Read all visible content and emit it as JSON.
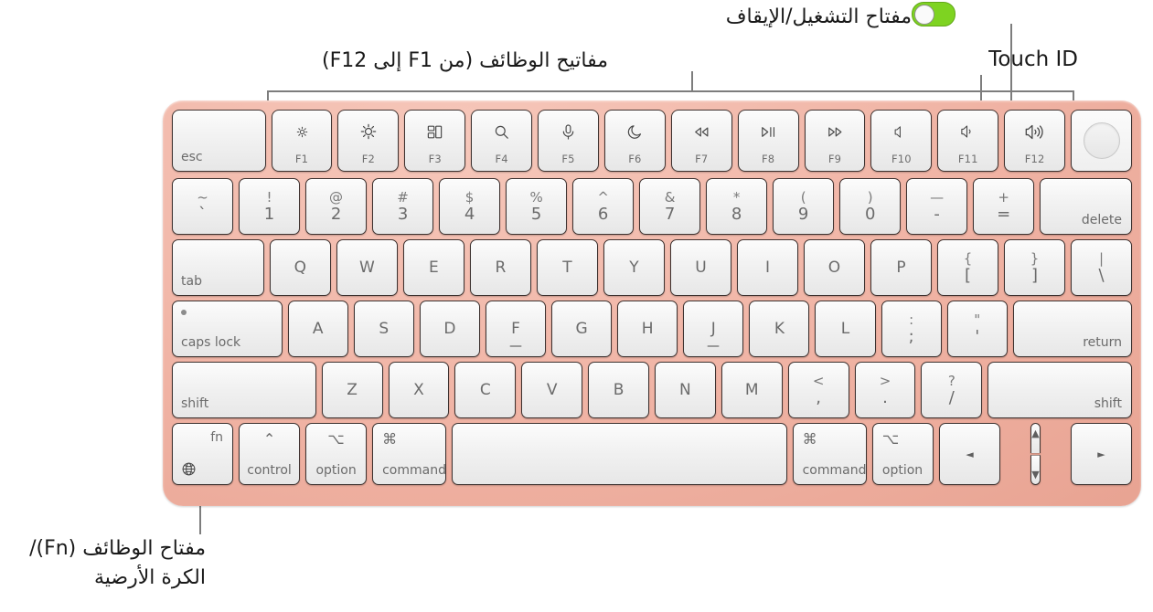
{
  "annotations": {
    "power_key": "مفتاح التشغيل/الإيقاف",
    "touch_id": "Touch ID",
    "function_keys": "مفاتيح الوظائف (من F1 إلى F12)",
    "fn_globe_key": "مفتاح الوظائف (Fn)/الكرة الأرضية"
  },
  "colors": {
    "keyboard_body": "#f0b3a4",
    "key_face": "#f2f2f2",
    "key_border": "#3d3230",
    "legend_text": "#6b6b6b",
    "leader_line": "#7d7d7d",
    "toggle_on": "#7ed321"
  },
  "keyboard": {
    "function_row": [
      {
        "name": "esc",
        "label": "esc",
        "caption": "",
        "icon": "",
        "width": 1.55,
        "style": "corner-bl"
      },
      {
        "name": "f1",
        "label": "",
        "caption": "F1",
        "icon": "brightness-down-icon",
        "width": 1.0,
        "style": "fnkey"
      },
      {
        "name": "f2",
        "label": "",
        "caption": "F2",
        "icon": "brightness-up-icon",
        "width": 1.0,
        "style": "fnkey"
      },
      {
        "name": "f3",
        "label": "",
        "caption": "F3",
        "icon": "mission-control-icon",
        "width": 1.0,
        "style": "fnkey"
      },
      {
        "name": "f4",
        "label": "",
        "caption": "F4",
        "icon": "search-icon",
        "width": 1.0,
        "style": "fnkey"
      },
      {
        "name": "f5",
        "label": "",
        "caption": "F5",
        "icon": "microphone-icon",
        "width": 1.0,
        "style": "fnkey"
      },
      {
        "name": "f6",
        "label": "",
        "caption": "F6",
        "icon": "moon-icon",
        "width": 1.0,
        "style": "fnkey"
      },
      {
        "name": "f7",
        "label": "",
        "caption": "F7",
        "icon": "rewind-icon",
        "width": 1.0,
        "style": "fnkey"
      },
      {
        "name": "f8",
        "label": "",
        "caption": "F8",
        "icon": "play-pause-icon",
        "width": 1.0,
        "style": "fnkey"
      },
      {
        "name": "f9",
        "label": "",
        "caption": "F9",
        "icon": "fast-forward-icon",
        "width": 1.0,
        "style": "fnkey"
      },
      {
        "name": "f10",
        "label": "",
        "caption": "F10",
        "icon": "mute-icon",
        "width": 1.0,
        "style": "fnkey"
      },
      {
        "name": "f11",
        "label": "",
        "caption": "F11",
        "icon": "volume-down-icon",
        "width": 1.0,
        "style": "fnkey"
      },
      {
        "name": "f12",
        "label": "",
        "caption": "F12",
        "icon": "volume-up-icon",
        "width": 1.0,
        "style": "fnkey"
      },
      {
        "name": "touch-id",
        "label": "",
        "caption": "",
        "icon": "touch-id-icon",
        "width": 1.0,
        "style": "touchid"
      }
    ],
    "number_row": [
      {
        "name": "grave",
        "top": "~",
        "bottom": "`",
        "width": 1.0
      },
      {
        "name": "one",
        "top": "!",
        "bottom": "1",
        "width": 1.0
      },
      {
        "name": "two",
        "top": "@",
        "bottom": "2",
        "width": 1.0
      },
      {
        "name": "three",
        "top": "#",
        "bottom": "3",
        "width": 1.0
      },
      {
        "name": "four",
        "top": "$",
        "bottom": "4",
        "width": 1.0
      },
      {
        "name": "five",
        "top": "%",
        "bottom": "5",
        "width": 1.0
      },
      {
        "name": "six",
        "top": "^",
        "bottom": "6",
        "width": 1.0
      },
      {
        "name": "seven",
        "top": "&",
        "bottom": "7",
        "width": 1.0
      },
      {
        "name": "eight",
        "top": "*",
        "bottom": "8",
        "width": 1.0
      },
      {
        "name": "nine",
        "top": "(",
        "bottom": "9",
        "width": 1.0
      },
      {
        "name": "zero",
        "top": ")",
        "bottom": "0",
        "width": 1.0
      },
      {
        "name": "minus",
        "top": "—",
        "bottom": "-",
        "width": 1.0
      },
      {
        "name": "equals",
        "top": "+",
        "bottom": "=",
        "width": 1.0
      },
      {
        "name": "delete",
        "top": "",
        "bottom": "delete",
        "width": 1.52,
        "style": "corner-br"
      }
    ],
    "qwerty_row": [
      {
        "name": "tab",
        "label": "tab",
        "width": 1.52,
        "style": "corner-bl"
      },
      {
        "name": "q",
        "label": "Q",
        "width": 1.0
      },
      {
        "name": "w",
        "label": "W",
        "width": 1.0
      },
      {
        "name": "e",
        "label": "E",
        "width": 1.0
      },
      {
        "name": "r",
        "label": "R",
        "width": 1.0
      },
      {
        "name": "t",
        "label": "T",
        "width": 1.0
      },
      {
        "name": "y",
        "label": "Y",
        "width": 1.0
      },
      {
        "name": "u",
        "label": "U",
        "width": 1.0
      },
      {
        "name": "i",
        "label": "I",
        "width": 1.0
      },
      {
        "name": "o",
        "label": "O",
        "width": 1.0
      },
      {
        "name": "p",
        "label": "P",
        "width": 1.0
      },
      {
        "name": "bracket-left",
        "top": "{",
        "bottom": "[",
        "width": 1.0,
        "style": "dual"
      },
      {
        "name": "bracket-right",
        "top": "}",
        "bottom": "]",
        "width": 1.0,
        "style": "dual"
      },
      {
        "name": "backslash",
        "top": "|",
        "bottom": "\\",
        "width": 1.0,
        "style": "dual"
      }
    ],
    "home_row": [
      {
        "name": "caps-lock",
        "label": "caps lock",
        "width": 1.85,
        "style": "corner-bl-dot"
      },
      {
        "name": "a",
        "label": "A",
        "width": 1.0
      },
      {
        "name": "s",
        "label": "S",
        "width": 1.0
      },
      {
        "name": "d",
        "label": "D",
        "width": 1.0
      },
      {
        "name": "f",
        "label": "F",
        "width": 1.0,
        "homing": true
      },
      {
        "name": "g",
        "label": "G",
        "width": 1.0
      },
      {
        "name": "h",
        "label": "H",
        "width": 1.0
      },
      {
        "name": "j",
        "label": "J",
        "width": 1.0,
        "homing": true
      },
      {
        "name": "k",
        "label": "K",
        "width": 1.0
      },
      {
        "name": "l",
        "label": "L",
        "width": 1.0
      },
      {
        "name": "semicolon",
        "top": ":",
        "bottom": ";",
        "width": 1.0,
        "style": "dual"
      },
      {
        "name": "quote",
        "top": "\"",
        "bottom": "'",
        "width": 1.0,
        "style": "dual"
      },
      {
        "name": "return",
        "label": "return",
        "width": 2.0,
        "style": "corner-br"
      }
    ],
    "shift_row": [
      {
        "name": "shift-left",
        "label": "shift",
        "width": 2.4,
        "style": "corner-bl"
      },
      {
        "name": "z",
        "label": "Z",
        "width": 1.0
      },
      {
        "name": "x",
        "label": "X",
        "width": 1.0
      },
      {
        "name": "c",
        "label": "C",
        "width": 1.0
      },
      {
        "name": "v",
        "label": "V",
        "width": 1.0
      },
      {
        "name": "b",
        "label": "B",
        "width": 1.0
      },
      {
        "name": "n",
        "label": "N",
        "width": 1.0
      },
      {
        "name": "m",
        "label": "M",
        "width": 1.0
      },
      {
        "name": "comma",
        "top": "<",
        "bottom": ",",
        "width": 1.0,
        "style": "dual"
      },
      {
        "name": "period",
        "top": ">",
        "bottom": ".",
        "width": 1.0,
        "style": "dual"
      },
      {
        "name": "slash",
        "top": "?",
        "bottom": "/",
        "width": 1.0,
        "style": "dual"
      },
      {
        "name": "shift-right",
        "label": "shift",
        "width": 2.4,
        "style": "corner-br"
      }
    ],
    "bottom_row": [
      {
        "name": "fn-globe",
        "label": "fn",
        "icon": "globe-icon",
        "width": 1.0,
        "style": "fn-globe"
      },
      {
        "name": "control-left",
        "glyph": "⌃",
        "word": "control",
        "width": 1.0,
        "style": "mod"
      },
      {
        "name": "option-left",
        "glyph": "⌥",
        "word": "option",
        "width": 1.0,
        "style": "mod"
      },
      {
        "name": "command-left",
        "glyph": "⌘",
        "word": "command",
        "width": 1.22,
        "style": "mod-right"
      },
      {
        "name": "space",
        "label": "",
        "width": 5.6
      },
      {
        "name": "command-right",
        "glyph": "⌘",
        "word": "command",
        "width": 1.22,
        "style": "mod-right"
      },
      {
        "name": "option-right",
        "glyph": "⌥",
        "word": "option",
        "width": 1.0,
        "style": "mod-right"
      },
      {
        "name": "arrow-left",
        "label": "◄",
        "width": 1.0,
        "style": "arrow"
      },
      {
        "name": "arrow-up-down",
        "up": "▲",
        "down": "▼",
        "width": 1.0,
        "style": "updown"
      },
      {
        "name": "arrow-right",
        "label": "►",
        "width": 1.0,
        "style": "arrow"
      }
    ]
  }
}
